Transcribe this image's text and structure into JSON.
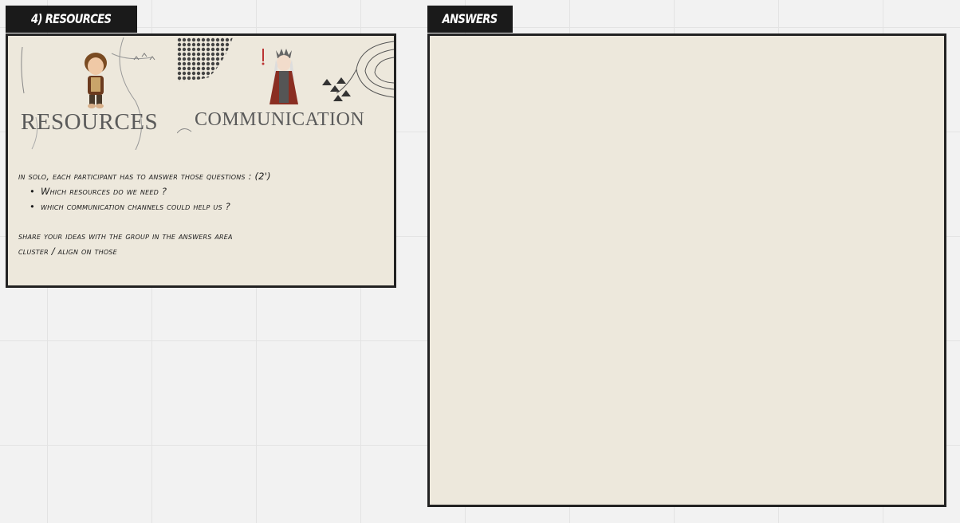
{
  "resources_frame": {
    "tab_label": "4) RESOURCES",
    "banner_left_text": "RESOURCES",
    "banner_right_text": "COMMUNICATION",
    "instructions": {
      "intro": "in solo, each participant has to answer those questions : (2')",
      "bullets": [
        "Which resources do we need ?",
        "which communication channels could help us ?"
      ],
      "share": "share your ideas with the group in the answers area",
      "cluster": "cluster / align on those"
    }
  },
  "answers_frame": {
    "tab_label": "ANSWERS"
  },
  "colors": {
    "canvas": "#f2f2f2",
    "frame_fill": "#ede8dc",
    "tab_fill": "#1a1a1a"
  }
}
